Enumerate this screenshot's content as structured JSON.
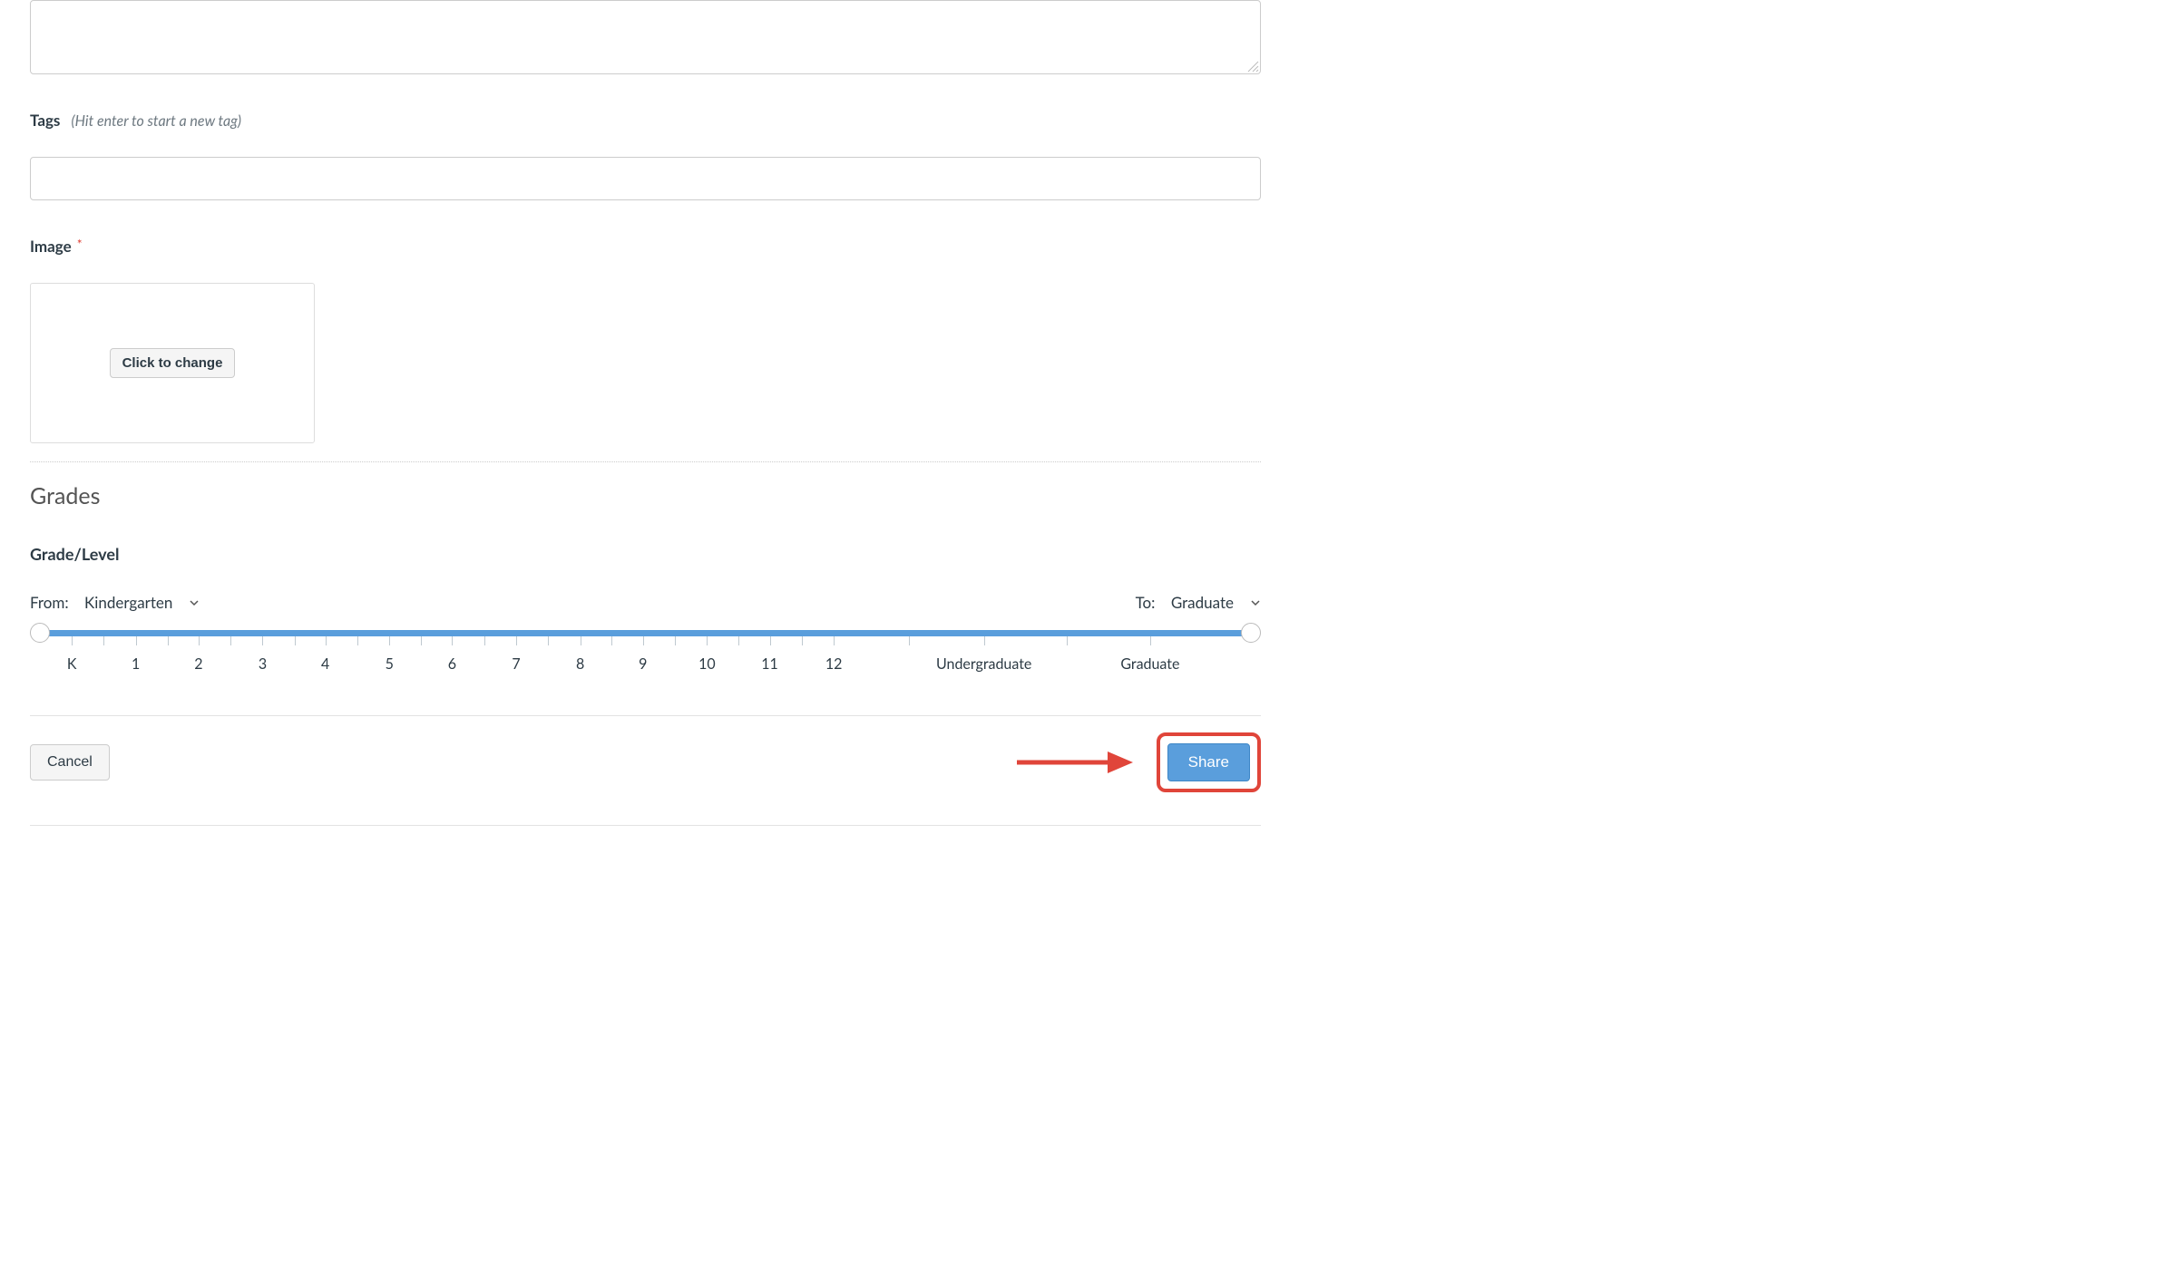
{
  "description": {
    "value": ""
  },
  "tags": {
    "label": "Tags",
    "hint": "(Hit enter to start a new tag)",
    "value": ""
  },
  "image": {
    "label": "Image",
    "button": "Click to change"
  },
  "grades": {
    "heading": "Grades",
    "subheading": "Grade/Level",
    "from_label": "From:",
    "from_value": "Kindergarten",
    "to_label": "To:",
    "to_value": "Graduate",
    "ticks": [
      "K",
      "1",
      "2",
      "3",
      "4",
      "5",
      "6",
      "7",
      "8",
      "9",
      "10",
      "11",
      "12",
      "Undergraduate",
      "Graduate"
    ]
  },
  "actions": {
    "cancel": "Cancel",
    "share": "Share"
  }
}
